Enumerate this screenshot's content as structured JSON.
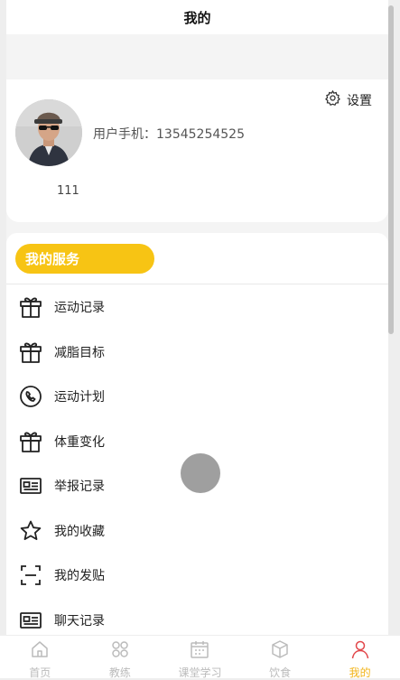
{
  "header": {
    "title": "我的"
  },
  "profile": {
    "phone_label": "用户手机：",
    "phone": "13545254525",
    "settings_label": "设置",
    "user_id": "111"
  },
  "services": {
    "title": "我的服务",
    "items": [
      {
        "label": "运动记录",
        "icon": "gift-icon"
      },
      {
        "label": "减脂目标",
        "icon": "gift-icon"
      },
      {
        "label": "运动计划",
        "icon": "phone-icon"
      },
      {
        "label": "体重变化",
        "icon": "gift-icon"
      },
      {
        "label": "举报记录",
        "icon": "id-card-icon"
      },
      {
        "label": "我的收藏",
        "icon": "star-icon"
      },
      {
        "label": "我的发贴",
        "icon": "scan-icon"
      },
      {
        "label": "聊天记录",
        "icon": "id-card-icon"
      }
    ]
  },
  "tabbar": {
    "items": [
      {
        "label": "首页",
        "icon": "home-icon"
      },
      {
        "label": "教练",
        "icon": "grid-icon"
      },
      {
        "label": "课堂学习",
        "icon": "calendar-icon"
      },
      {
        "label": "饮食",
        "icon": "box-icon"
      },
      {
        "label": "我的",
        "icon": "user-icon",
        "active": true
      }
    ]
  },
  "colors": {
    "accent": "#f7c414",
    "active_tab": "#f2b41a"
  }
}
